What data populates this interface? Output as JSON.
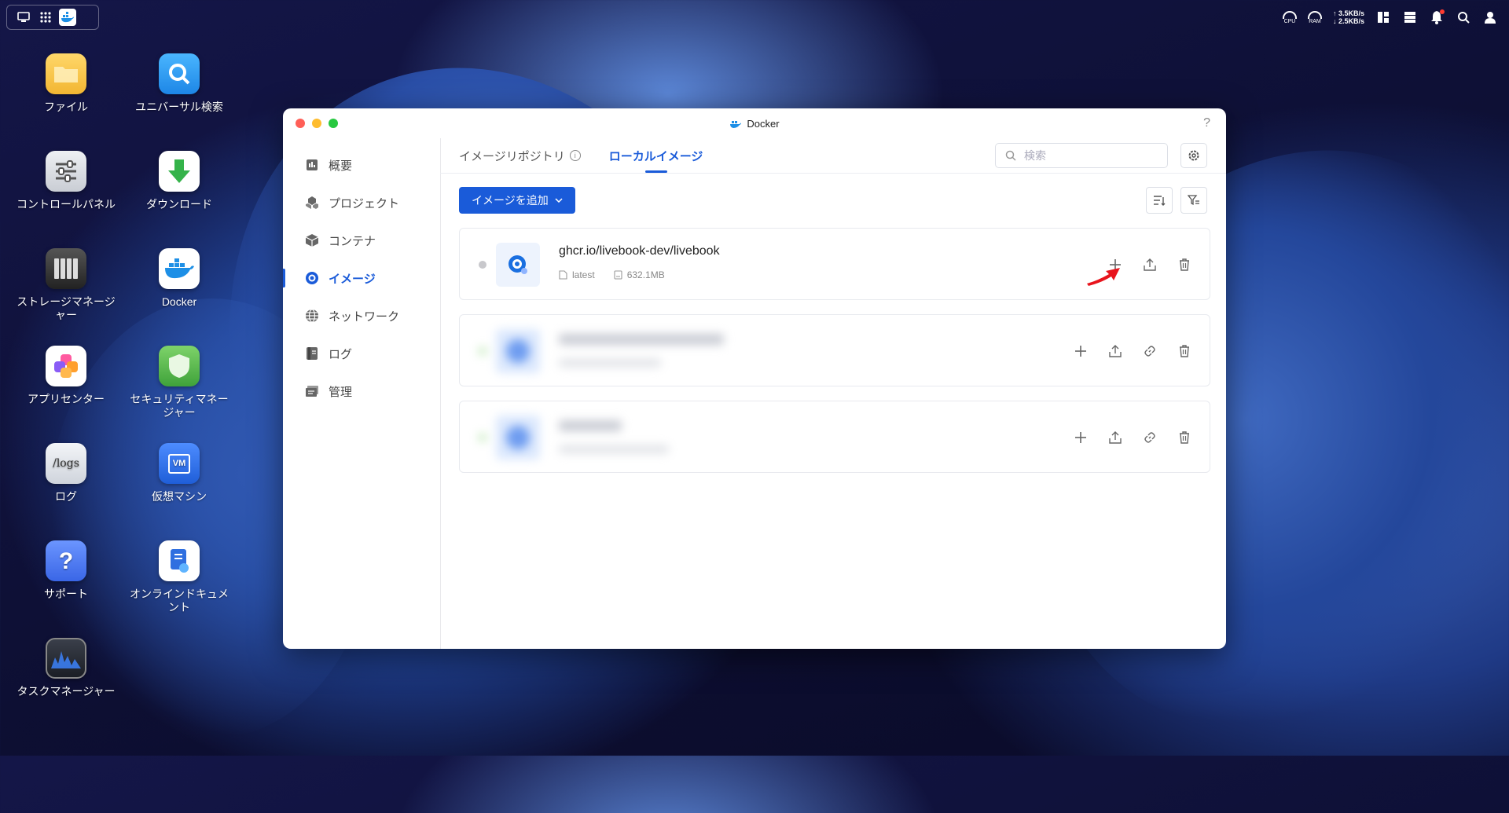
{
  "desktop": {
    "icons": [
      {
        "label": "ファイル",
        "icon": "folder-icon",
        "color": "#f5c542"
      },
      {
        "label": "ユニバーサル検索",
        "icon": "universal-search-icon",
        "color": "#2e9df4"
      },
      {
        "label": "コントロールパネル",
        "icon": "control-panel-icon",
        "color": "#9aa0a8"
      },
      {
        "label": "ダウンロード",
        "icon": "download-icon",
        "color": "#3fb34f"
      },
      {
        "label": "ストレージマネージャー",
        "icon": "storage-manager-icon",
        "color": "#333333"
      },
      {
        "label": "Docker",
        "icon": "docker-icon",
        "color": "#1d8fe6"
      },
      {
        "label": "アプリセンター",
        "icon": "app-center-icon",
        "color": "#ff7a3d"
      },
      {
        "label": "セキュリティマネージャー",
        "icon": "security-manager-icon",
        "color": "#56b84a"
      },
      {
        "label": "ログ",
        "icon": "logs-icon",
        "color": "#d8dce4",
        "text": "/logs"
      },
      {
        "label": "仮想マシン",
        "icon": "virtual-machine-icon",
        "color": "#2f6fe0",
        "text": "VM"
      },
      {
        "label": "サポート",
        "icon": "support-icon",
        "color": "#4d7df2",
        "text": "?"
      },
      {
        "label": "オンラインドキュメント",
        "icon": "online-docs-icon",
        "color": "#ffffff"
      },
      {
        "label": "タスクマネージャー",
        "icon": "task-manager-icon",
        "color": "#2a2f3a"
      }
    ]
  },
  "topbar": {
    "cpu_label": "CPU",
    "ram_label": "RAM",
    "upload": "↑ 3.5KB/s",
    "download": "↓ 2.5KB/s"
  },
  "window": {
    "title": "Docker",
    "help": "?",
    "sidebar": [
      {
        "label": "概要",
        "icon": "overview-icon"
      },
      {
        "label": "プロジェクト",
        "icon": "project-icon"
      },
      {
        "label": "コンテナ",
        "icon": "container-icon"
      },
      {
        "label": "イメージ",
        "icon": "image-icon",
        "active": true
      },
      {
        "label": "ネットワーク",
        "icon": "network-icon"
      },
      {
        "label": "ログ",
        "icon": "log-icon"
      },
      {
        "label": "管理",
        "icon": "manage-icon"
      }
    ],
    "tabs": [
      {
        "label": "イメージリポジトリ"
      },
      {
        "label": "ローカルイメージ",
        "active": true
      }
    ],
    "search": {
      "placeholder": "検索",
      "value": ""
    },
    "add_button": "イメージを追加",
    "images": [
      {
        "name": "ghcr.io/livebook-dev/livebook",
        "tag": "latest",
        "size": "632.1MB"
      }
    ]
  },
  "colors": {
    "accent": "#1a5bd9",
    "arrow": "#e8141c"
  }
}
